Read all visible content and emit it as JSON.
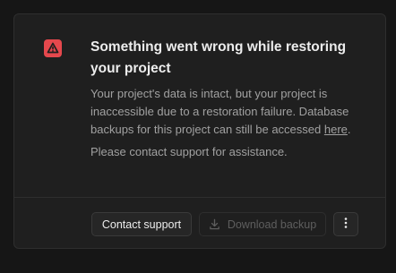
{
  "alert": {
    "icon": "warning-triangle-icon",
    "icon_color": "#e5484d",
    "title": "Something went wrong while restoring your project",
    "description_before_link": "Your project's data is intact, but your project is inaccessible due to a restoration failure. Database backups for this project can still be accessed ",
    "link_text": "here",
    "description_after_link": ".",
    "support_text": "Please contact support for assistance."
  },
  "actions": {
    "contact_label": "Contact support",
    "download_label": "Download backup",
    "download_icon": "download-icon",
    "more_icon": "more-vertical-icon"
  }
}
